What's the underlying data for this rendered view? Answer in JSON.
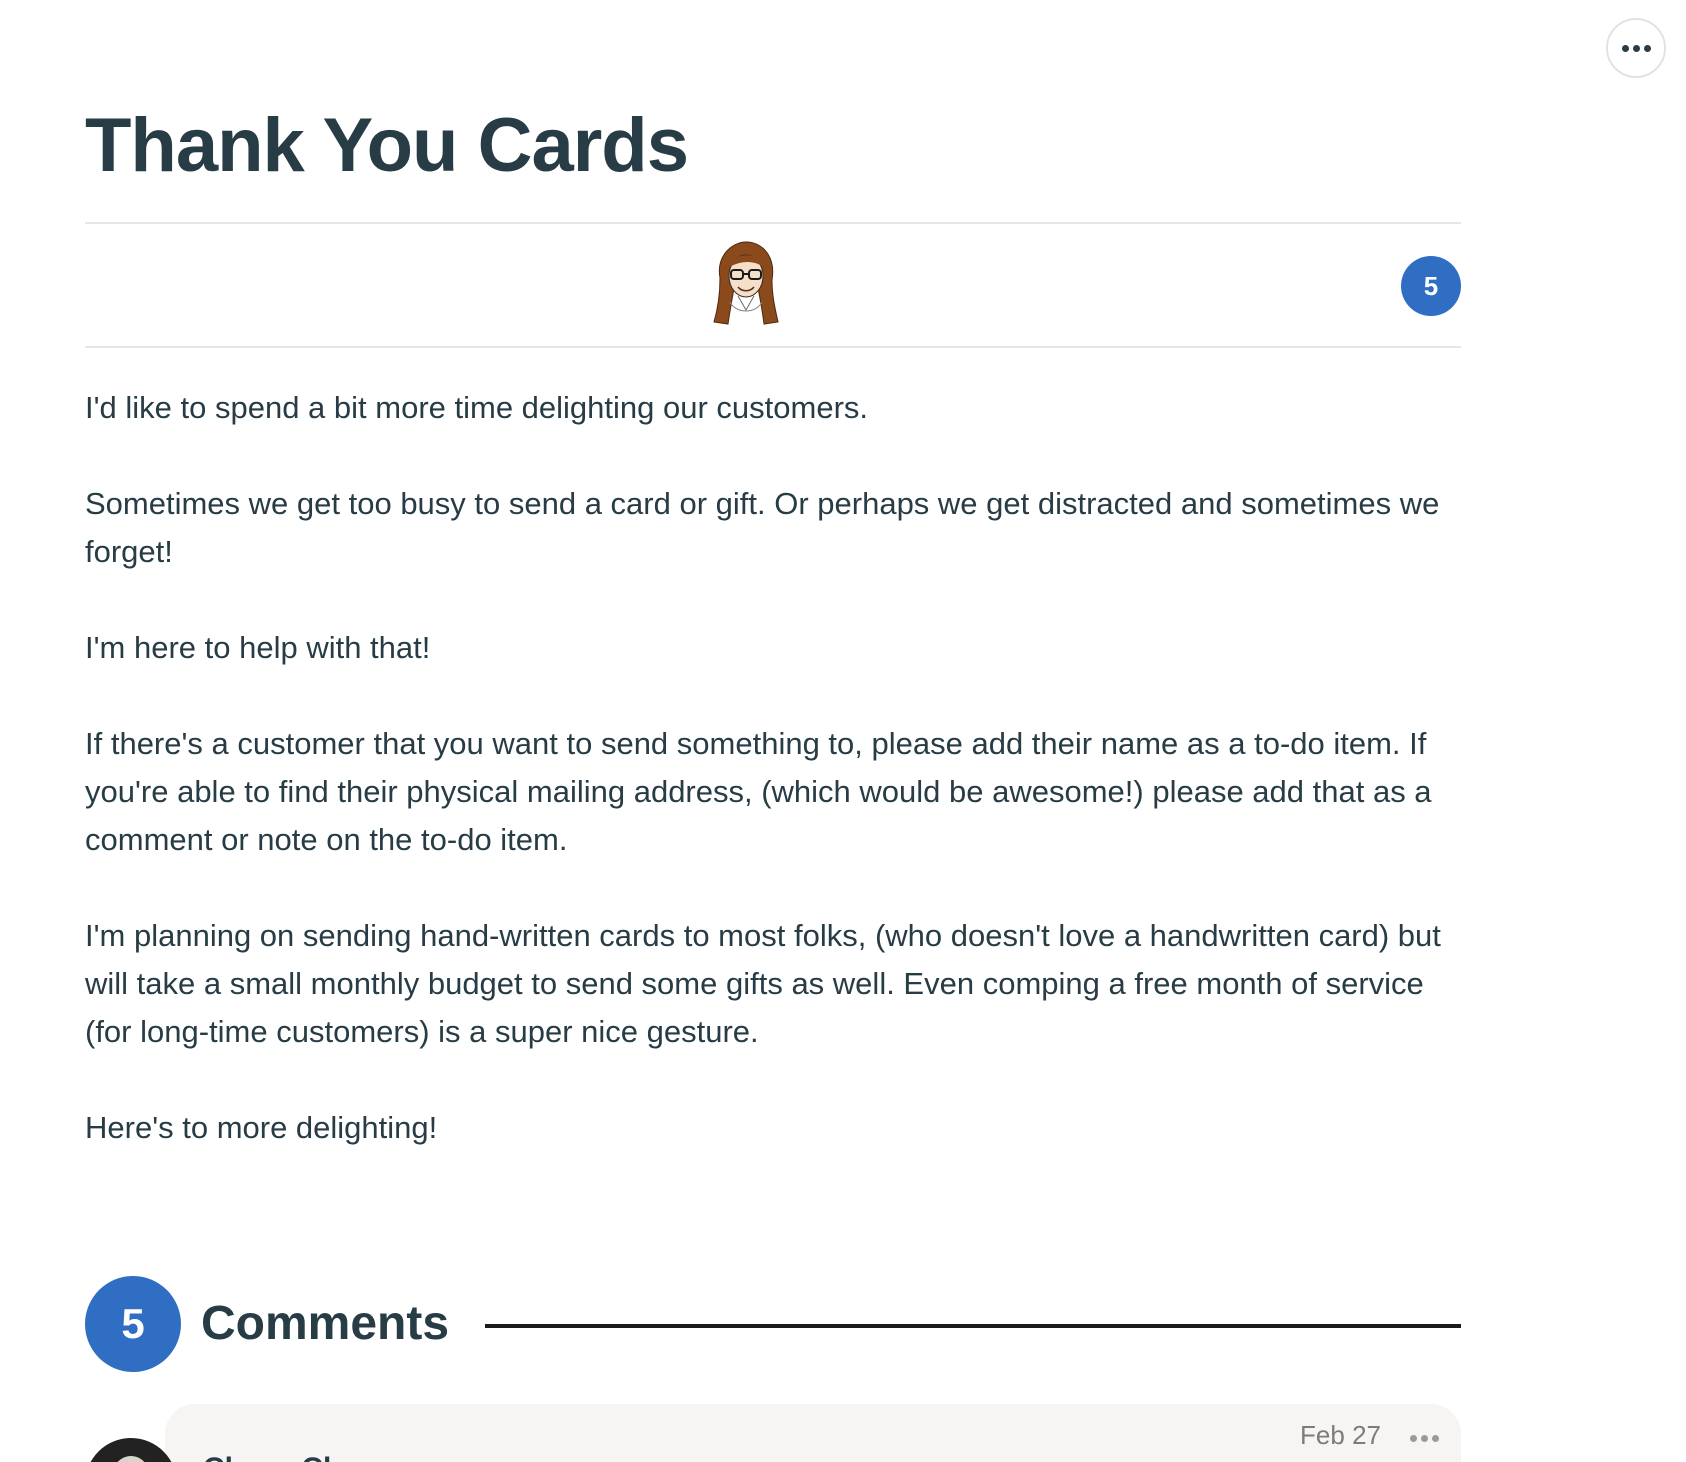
{
  "toolbar": {
    "more_label": "More options"
  },
  "document": {
    "title": "Thank You Cards",
    "boost_count": "5",
    "paragraphs": [
      "I'd like to spend a bit more time delighting our customers.",
      "Sometimes we get too busy to send a card or gift. Or perhaps we get distracted and sometimes we forget!",
      "I'm here to help with that!",
      "If there's a customer that you want to send something to, please add their name as a to-do item. If you're able to find their physical mailing address, (which would be awesome!) please add that as a comment or note on the to-do item.",
      "I'm planning on sending hand-written cards to most folks, (who doesn't love a handwritten card) but will take a small monthly budget to send some gifts as well. Even comping a free month of service (for long-time customers) is a super nice gesture.",
      "Here's to more delighting!"
    ]
  },
  "comments": {
    "count": "5",
    "label": "Comments",
    "items": [
      {
        "author": "Chase Clemons",
        "date": "Feb 27"
      }
    ]
  },
  "colors": {
    "accent": "#2f6ec2",
    "text": "#283c46",
    "divider": "#e6e6e6",
    "comment_bg": "#f6f5f3"
  },
  "icons": {
    "more": "ellipsis-icon",
    "comment_menu": "ellipsis-icon"
  }
}
